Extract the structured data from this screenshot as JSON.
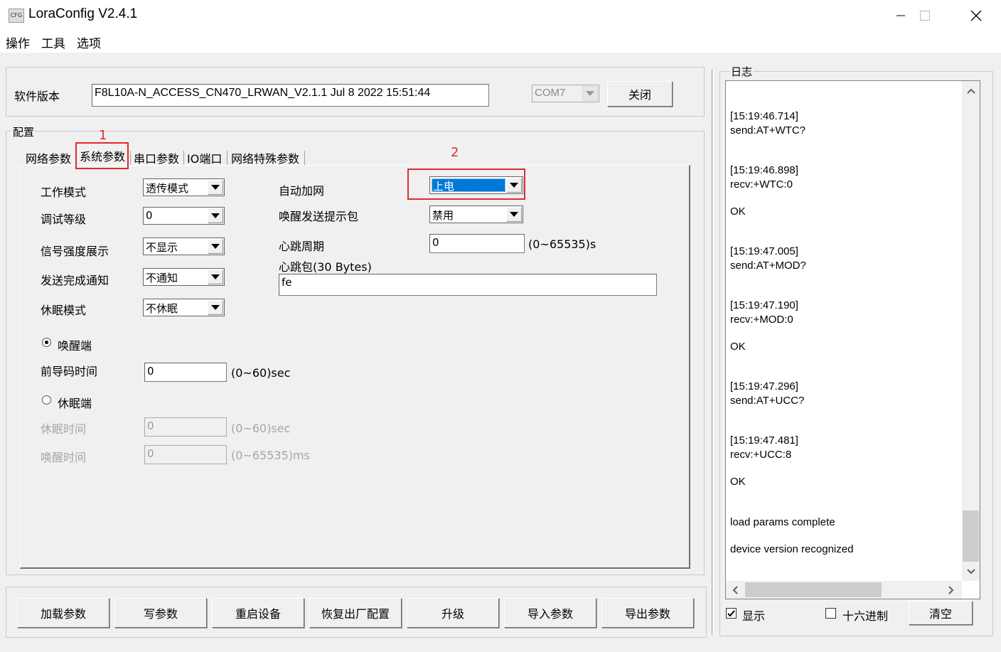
{
  "window": {
    "title": "LoraConfig V2.4.1",
    "icon_text": "CFG"
  },
  "menu": [
    "操作",
    "工具",
    "选项"
  ],
  "top": {
    "version_label": "软件版本",
    "version_value": "F8L10A-N_ACCESS_CN470_LRWAN_V2.1.1 Jul  8 2022 15:51:44",
    "port_value": "COM7",
    "close_label": "关闭"
  },
  "config": {
    "group_label": "配置",
    "tabs": [
      "网络参数",
      "系统参数",
      "串口参数",
      "IO端口",
      "网络特殊参数"
    ],
    "annotation_1": "1",
    "annotation_2": "2",
    "left": {
      "work_mode_label": "工作模式",
      "work_mode_value": "透传模式",
      "debug_level_label": "调试等级",
      "debug_level_value": "0",
      "signal_label": "信号强度展示",
      "signal_value": "不显示",
      "send_notify_label": "发送完成通知",
      "send_notify_value": "不通知",
      "sleep_mode_label": "休眠模式",
      "sleep_mode_value": "不休眠",
      "wake_end_label": "唤醒端",
      "preamble_label": "前导码时间",
      "preamble_value": "0",
      "preamble_unit": "(0~60)sec",
      "sleep_end_label": "休眠端",
      "sleep_time_label": "休眠时间",
      "sleep_time_value": "0",
      "sleep_time_unit": "(0~60)sec",
      "wake_time_label": "唤醒时间",
      "wake_time_value": "0",
      "wake_time_unit": "(0~65535)ms"
    },
    "right": {
      "auto_join_label": "自动加网",
      "auto_join_value": "上电",
      "wake_tip_label": "唤醒发送提示包",
      "wake_tip_value": "禁用",
      "heartbeat_period_label": "心跳周期",
      "heartbeat_period_value": "0",
      "heartbeat_period_unit": "(0~65535)s",
      "heartbeat_pkg_label": "心跳包(30 Bytes)",
      "heartbeat_pkg_value": "fe"
    }
  },
  "buttons": [
    "加载参数",
    "写参数",
    "重启设备",
    "恢复出厂配置",
    "升级",
    "导入参数",
    "导出参数"
  ],
  "log": {
    "label": "日志",
    "lines": [
      "[15:19:46.714]",
      "send:AT+WTC?",
      "[15:19:46.898]",
      "recv:+WTC:0",
      "OK",
      "[15:19:47.005]",
      "send:AT+MOD?",
      "[15:19:47.190]",
      "recv:+MOD:0",
      "OK",
      "[15:19:47.296]",
      "send:AT+UCC?",
      "[15:19:47.481]",
      "recv:+UCC:8",
      "OK",
      "load params complete",
      "device version recognized"
    ],
    "show_label": "显示",
    "hex_label": "十六进制",
    "clear_label": "清空"
  }
}
